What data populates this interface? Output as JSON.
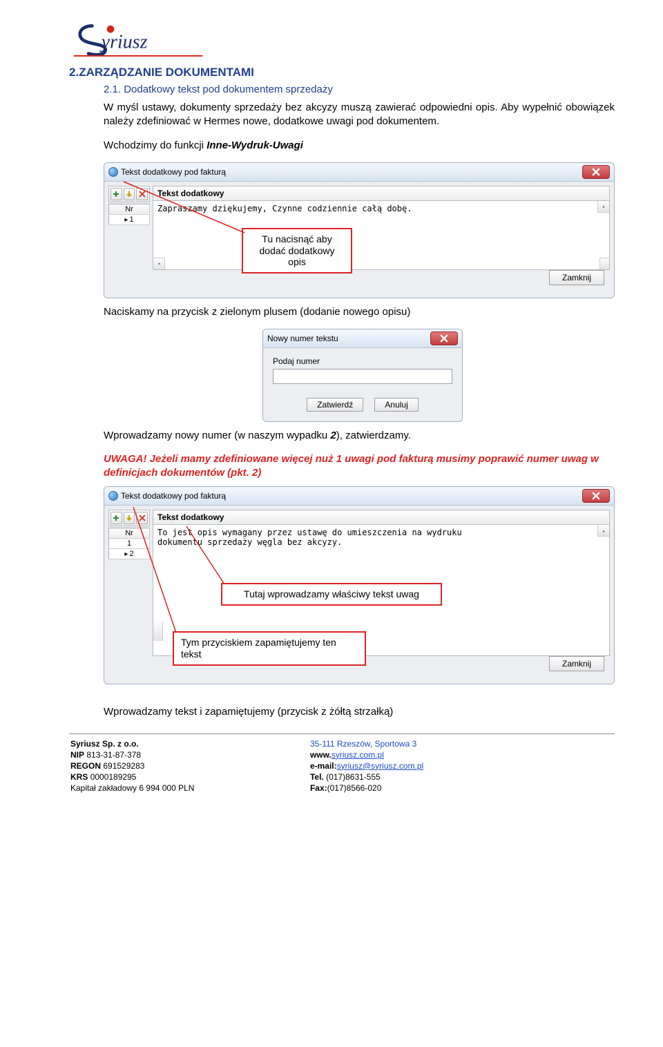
{
  "logo": {
    "name": "Syriusz"
  },
  "section": {
    "num": "2.",
    "title": "ZARZĄDZANIE DOKUMENTAMI"
  },
  "subsection": {
    "num": "2.1.",
    "title": "Dodatkowy tekst pod dokumentem sprzedaży"
  },
  "para1": "W myśl ustawy, dokumenty sprzedaży bez akcyzy muszą zawierać odpowiedni opis. Aby wypełnić obowiązek należy zdefiniować w Hermes nowe, dodatkowe uwagi pod dokumentem.",
  "para2_prefix": "Wchodzimy do funkcji ",
  "para2_menu": "Inne-Wydruk-Uwagi",
  "window1": {
    "title": "Tekst dodatkowy pod fakturą",
    "header": "Tekst dodatkowy",
    "content": "Zapraszamy dziękujemy, Czynne codziennie całą dobę.",
    "nr_header": "Nr",
    "nr_rows": [
      "1"
    ],
    "close": "Zamknij"
  },
  "callout1": "Tu nacisnąć aby\ndodać dodatkowy\nopis",
  "para3": "Naciskamy na przycisk z zielonym plusem (dodanie nowego opisu)",
  "dialog": {
    "title": "Nowy numer tekstu",
    "label": "Podaj numer",
    "value": "",
    "btn_ok": "Zatwierdź",
    "btn_cancel": "Anuluj"
  },
  "para4_a": "Wprowadzamy nowy numer (w naszym wypadku ",
  "para4_num": "2",
  "para4_b": "), zatwierdzamy.",
  "uwaga": "UWAGA! Jeżeli mamy zdefiniowane więcej nuż 1 uwagi pod fakturą musimy poprawić numer uwag w definicjach dokumentów (pkt. 2)",
  "window2": {
    "title": "Tekst dodatkowy pod fakturą",
    "header": "Tekst dodatkowy",
    "content": "To jest opis wymagany przez ustawę do umieszczenia na wydruku\ndokumentu sprzedaży węgla bez akcyzy.",
    "nr_header": "Nr",
    "nr_rows": [
      "1",
      "2"
    ],
    "close": "Zamknij"
  },
  "callout2": "Tutaj wprowadzamy właściwy tekst uwag",
  "callout3": "Tym przyciskiem zapamiętujemy\nten tekst",
  "para5": "Wprowadzamy tekst i zapamiętujemy (przycisk z żółtą strzałką)",
  "footer": {
    "company": "Syriusz Sp. z o.o.",
    "nip_l": "NIP",
    "nip_v": "813-31-87-378",
    "regon_l": "REGON",
    "regon_v": "691529283",
    "krs_l": "KRS",
    "krs_v": "0000189295",
    "cap": "Kapitał zakładowy 6 994 000 PLN",
    "addr": "35-111 Rzeszów, Sportowa 3",
    "www_l": "www.",
    "www_v": "syriusz.com.pl",
    "email_l": "e-mail:",
    "email_v": "syriusz@syriusz.com.pl",
    "tel_l": "Tel.",
    "tel_v": "(017)8631-555",
    "fax_l": "Fax:",
    "fax_v": "(017)8566-020"
  }
}
